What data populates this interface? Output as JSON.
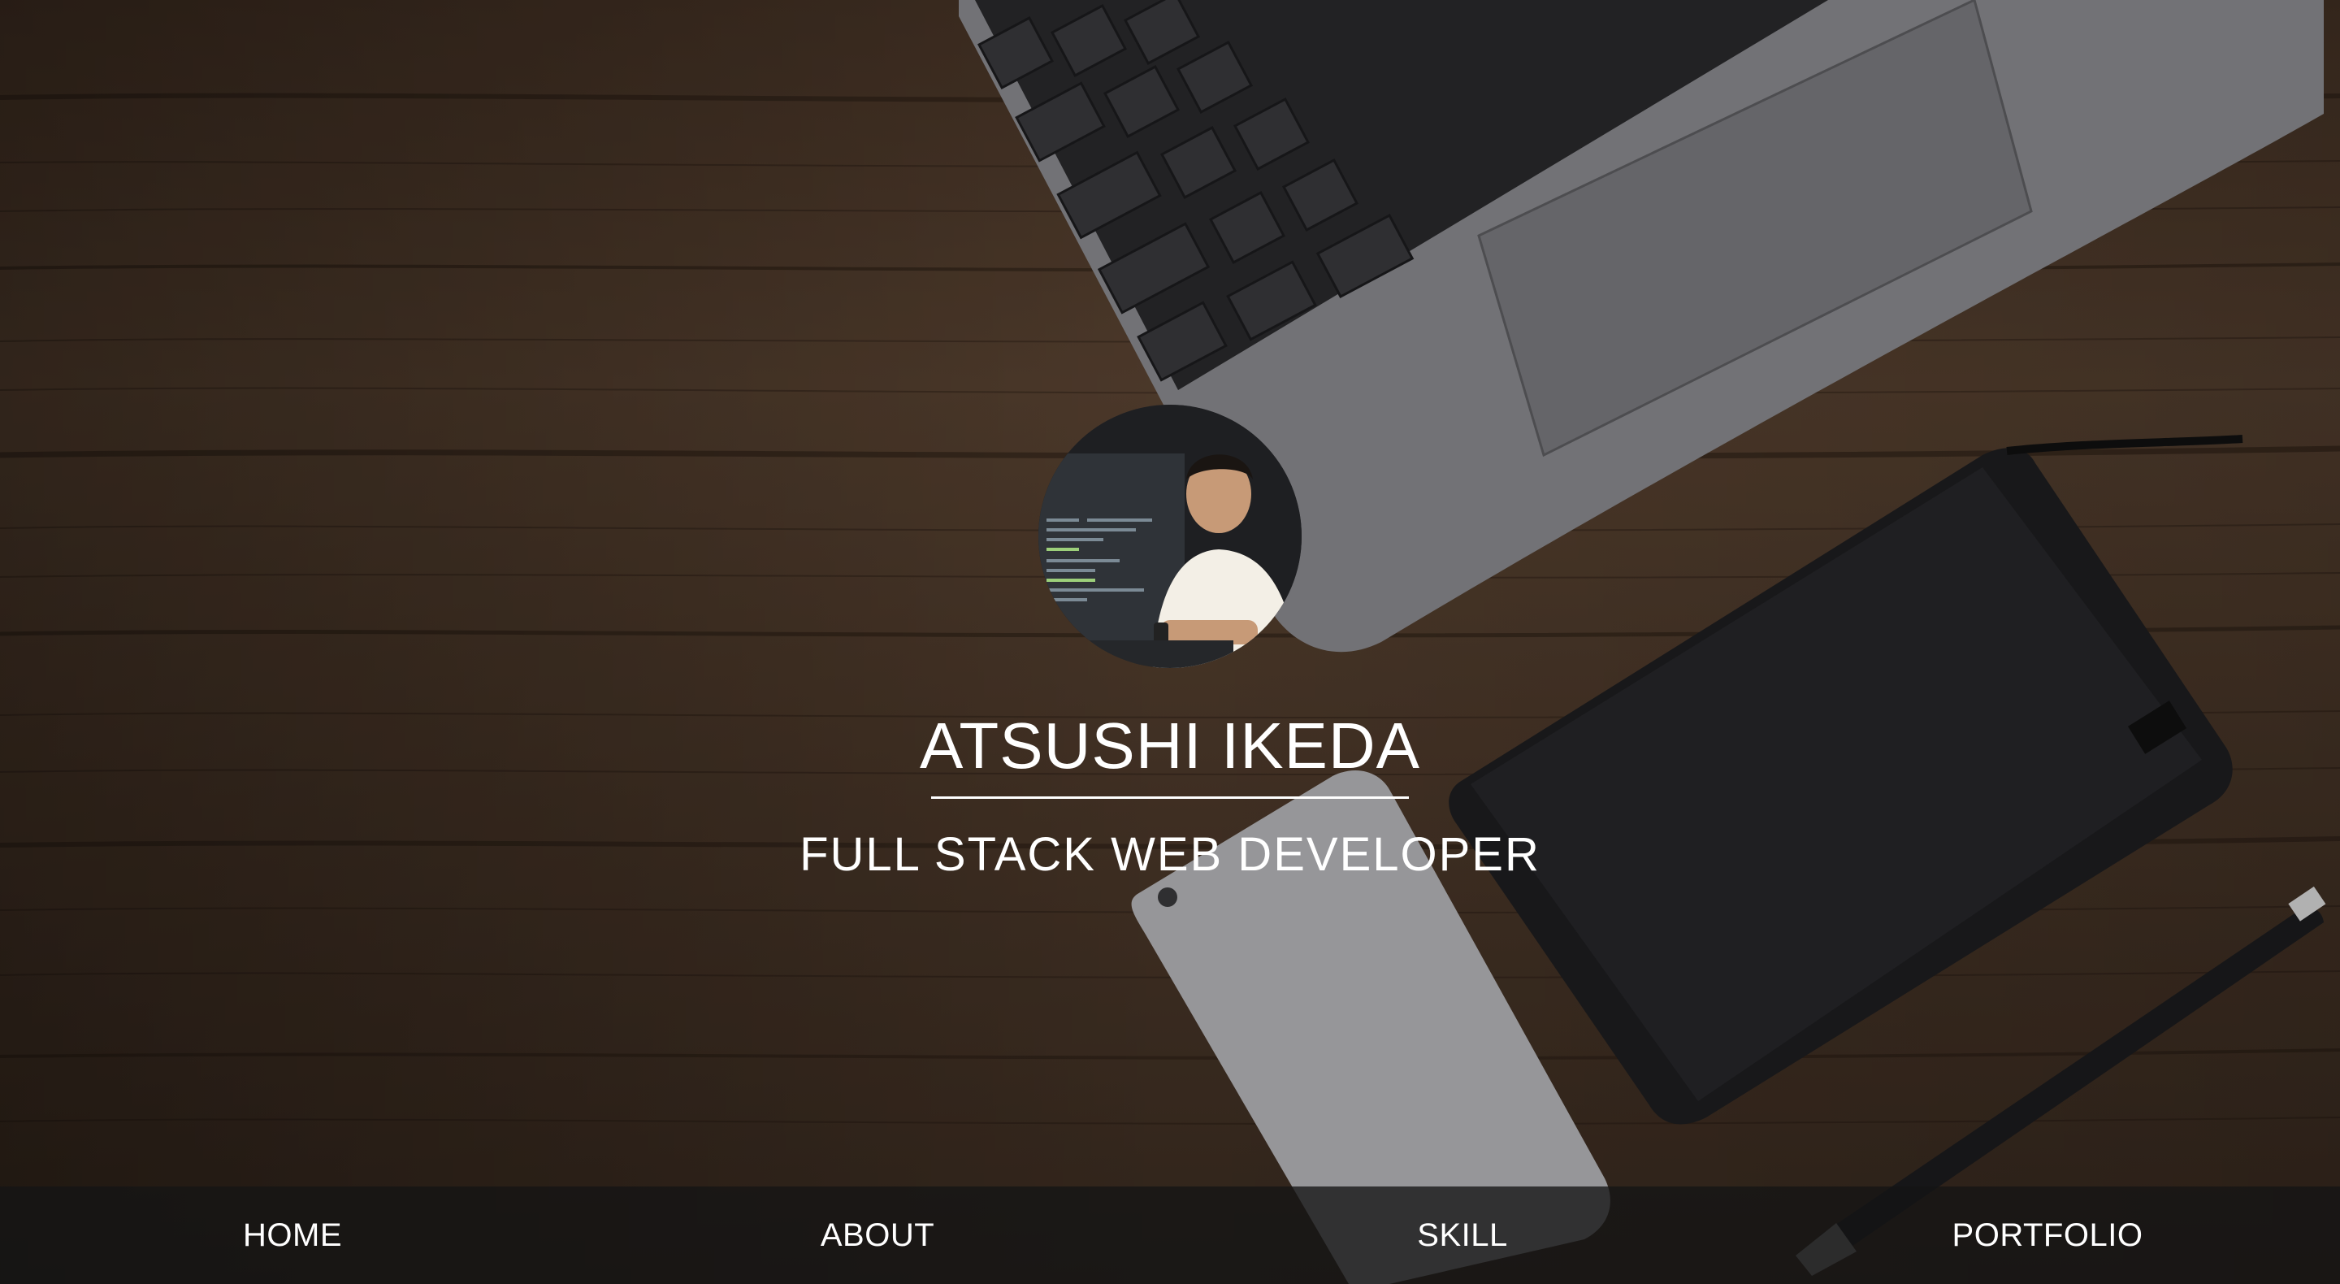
{
  "hero": {
    "name": "ATSUSHI IKEDA",
    "title": "FULL STACK WEB DEVELOPER",
    "background": "desk-workspace-photo",
    "avatar": "profile-photo"
  },
  "nav": {
    "items": [
      {
        "label": "HOME"
      },
      {
        "label": "ABOUT"
      },
      {
        "label": "SKILL"
      },
      {
        "label": "PORTFOLIO"
      }
    ]
  },
  "colors": {
    "text": "#ffffff",
    "navbar_bg": "#141414",
    "wood": "#5a4330"
  }
}
